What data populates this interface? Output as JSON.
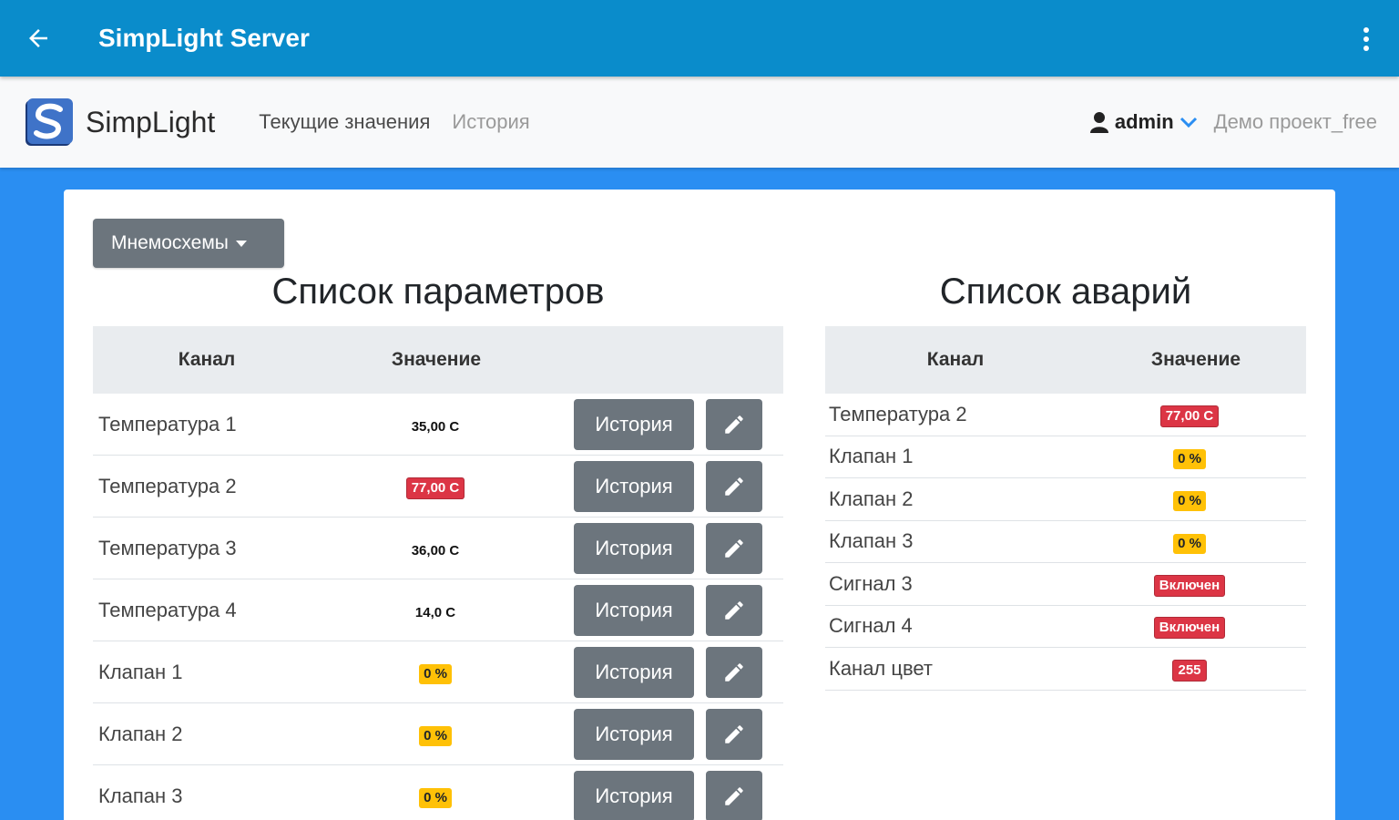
{
  "appbar": {
    "title": "SimpLight Server",
    "back_icon": "arrow-left-icon",
    "menu_icon": "more-vert-icon"
  },
  "navbar": {
    "brand": "SimpLight",
    "links": [
      "Текущие значения",
      "История"
    ],
    "user": "admin",
    "project": "Демо проект_free"
  },
  "dropdown": {
    "label": "Мнемосхемы"
  },
  "params": {
    "title": "Список параметров",
    "col_channel": "Канал",
    "col_value": "Значение",
    "history_label": "История",
    "rows": [
      {
        "channel": "Температура 1",
        "value": "35,00 C",
        "style": "plain"
      },
      {
        "channel": "Температура 2",
        "value": "77,00 C",
        "style": "red"
      },
      {
        "channel": "Температура 3",
        "value": "36,00 C",
        "style": "plain"
      },
      {
        "channel": "Температура 4",
        "value": "14,0 C",
        "style": "plain"
      },
      {
        "channel": "Клапан 1",
        "value": "0 %",
        "style": "yellow"
      },
      {
        "channel": "Клапан 2",
        "value": "0 %",
        "style": "yellow"
      },
      {
        "channel": "Клапан 3",
        "value": "0 %",
        "style": "yellow"
      }
    ]
  },
  "alarms": {
    "title": "Список аварий",
    "col_channel": "Канал",
    "col_value": "Значение",
    "rows": [
      {
        "channel": "Температура 2",
        "value": "77,00 C",
        "style": "red"
      },
      {
        "channel": "Клапан 1",
        "value": "0 %",
        "style": "yellow"
      },
      {
        "channel": "Клапан 2",
        "value": "0 %",
        "style": "yellow"
      },
      {
        "channel": "Клапан 3",
        "value": "0 %",
        "style": "yellow"
      },
      {
        "channel": "Сигнал 3",
        "value": "Включен",
        "style": "red"
      },
      {
        "channel": "Сигнал 4",
        "value": "Включен",
        "style": "red"
      },
      {
        "channel": "Канал цвет",
        "value": "255",
        "style": "red"
      }
    ]
  },
  "colors": {
    "appbar": "#0a8ccb",
    "background": "#2a8ef2",
    "button": "#6c757d",
    "danger": "#dc3545",
    "warning": "#ffc107"
  }
}
